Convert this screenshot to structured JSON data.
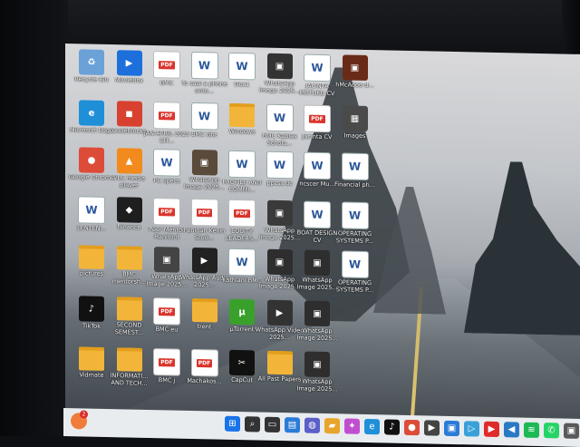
{
  "desktop": {
    "icons": [
      {
        "label": "Recycle Bin",
        "kind": "img",
        "glyph": "♻",
        "color": "#6aa2d8"
      },
      {
        "label": "MovieBox",
        "kind": "img",
        "glyph": "▶",
        "color": "#1d6fdc"
      },
      {
        "label": "BMC",
        "kind": "pdf",
        "glyph": "PDF"
      },
      {
        "label": "To cast a phone onto...",
        "kind": "word",
        "glyph": "W"
      },
      {
        "label": "Doc1",
        "kind": "word",
        "glyph": "W"
      },
      {
        "label": "WhatsApp Image 2025...",
        "kind": "img",
        "glyph": "▣",
        "color": "#333"
      },
      {
        "label": "JACINTA MUTUKU CV",
        "kind": "word",
        "glyph": "W"
      },
      {
        "label": "hMcAdee-d...",
        "kind": "img",
        "glyph": "▣",
        "color": "#6a2a18"
      },
      {
        "label": "Microsoft Edge",
        "kind": "img",
        "glyph": "e",
        "color": "#1f8fd8"
      },
      {
        "label": "CodeBlocks",
        "kind": "img",
        "glyph": "◼",
        "color": "#d8412f"
      },
      {
        "label": "JAN-APRIL 2025 CIT...",
        "kind": "pdf",
        "glyph": "PDF"
      },
      {
        "label": "BMC Bbc",
        "kind": "word",
        "glyph": "W"
      },
      {
        "label": "Windows",
        "kind": "folder",
        "glyph": ""
      },
      {
        "label": "BMC Kabias Schola...",
        "kind": "word",
        "glyph": "W"
      },
      {
        "label": "Jacinta CV",
        "kind": "pdf",
        "glyph": "PDF"
      },
      {
        "label": "Images",
        "kind": "img",
        "glyph": "▦",
        "color": "#4a4a4a"
      },
      {
        "label": "Google Chrome",
        "kind": "img",
        "glyph": "●",
        "color": "#dd4b39"
      },
      {
        "label": "VLC media player",
        "kind": "img",
        "glyph": "▲",
        "color": "#f28a1d"
      },
      {
        "label": "PC specs",
        "kind": "word",
        "glyph": "W"
      },
      {
        "label": "WhatsApp Image 2025...",
        "kind": "img",
        "glyph": "▣",
        "color": "#5a4a3a"
      },
      {
        "label": "PROFILE AND COMMI...",
        "kind": "word",
        "glyph": "W"
      },
      {
        "label": "ppcss.dc",
        "kind": "word",
        "glyph": "W"
      },
      {
        "label": "ncscer Mu...",
        "kind": "word",
        "glyph": "W"
      },
      {
        "label": "Financial ph...",
        "kind": "word",
        "glyph": "W"
      },
      {
        "label": "LENTEN...",
        "kind": "word",
        "glyph": "W"
      },
      {
        "label": "Binance",
        "kind": "img",
        "glyph": "◆",
        "color": "#1e1e1e"
      },
      {
        "label": "Peer Mentor Handout",
        "kind": "pdf",
        "glyph": "PDF"
      },
      {
        "label": "Peninah Kevin Stud...",
        "kind": "pdf",
        "glyph": "PDF"
      },
      {
        "label": "EQUITY LEADERS...",
        "kind": "pdf",
        "glyph": "PDF"
      },
      {
        "label": "WhatsApp Image 2025...",
        "kind": "img",
        "glyph": "▣",
        "color": "#3a3a3a"
      },
      {
        "label": "BOAT DESIGN CV",
        "kind": "word",
        "glyph": "W"
      },
      {
        "label": "OPERATING SYSTEMS P...",
        "kind": "word",
        "glyph": "W"
      },
      {
        "label": "pictures",
        "kind": "folder",
        "glyph": ""
      },
      {
        "label": "BMC mentorsh...",
        "kind": "folder",
        "glyph": ""
      },
      {
        "label": "WhatsApp Image 2025...",
        "kind": "img",
        "glyph": "▣",
        "color": "#444"
      },
      {
        "label": "WhatsApp Audio 2025...",
        "kind": "img",
        "glyph": "▶",
        "color": "#222"
      },
      {
        "label": "kathiani BMC",
        "kind": "word",
        "glyph": "W"
      },
      {
        "label": "WhatsApp Image 2025...",
        "kind": "img",
        "glyph": "▣",
        "color": "#2e2e2e"
      },
      {
        "label": "WhatsApp Image 2025...",
        "kind": "img",
        "glyph": "▣",
        "color": "#2e2e2e"
      },
      {
        "label": "OPERATING SYSTEMS P...",
        "kind": "word",
        "glyph": "W"
      },
      {
        "label": "TikTok",
        "kind": "img",
        "glyph": "♪",
        "color": "#111"
      },
      {
        "label": "SECOND SEMEST...",
        "kind": "folder",
        "glyph": ""
      },
      {
        "label": "BMC eu",
        "kind": "pdf",
        "glyph": "PDF"
      },
      {
        "label": "trent",
        "kind": "folder",
        "glyph": ""
      },
      {
        "label": "µTorrent",
        "kind": "img",
        "glyph": "µ",
        "color": "#3aa02c"
      },
      {
        "label": "WhatsApp Video 2025...",
        "kind": "img",
        "glyph": "▶",
        "color": "#333"
      },
      {
        "label": "WhatsApp Image 2025...",
        "kind": "img",
        "glyph": "▣",
        "color": "#2e2e2e"
      },
      {
        "label": "Vidmate",
        "kind": "folder",
        "glyph": ""
      },
      {
        "label": "INFORMATI... AND TECH...",
        "kind": "folder",
        "glyph": ""
      },
      {
        "label": "BMC j",
        "kind": "pdf",
        "glyph": "PDF"
      },
      {
        "label": "Machakos...",
        "kind": "pdf",
        "glyph": "PDF"
      },
      {
        "label": "CapCut",
        "kind": "img",
        "glyph": "✂",
        "color": "#111"
      },
      {
        "label": "All Past Papers",
        "kind": "folder",
        "glyph": ""
      },
      {
        "label": "WhatsApp Image 2025...",
        "kind": "img",
        "glyph": "▣",
        "color": "#2e2e2e"
      }
    ]
  },
  "taskbar": {
    "notification_count": "2",
    "apps": [
      {
        "name": "start-icon",
        "glyph": "⊞",
        "color": "#1a73e8"
      },
      {
        "name": "search-icon",
        "glyph": "⌕",
        "color": "#333"
      },
      {
        "name": "task-view-icon",
        "glyph": "▭",
        "color": "#333"
      },
      {
        "name": "widgets-icon",
        "glyph": "▤",
        "color": "#2b7bd8"
      },
      {
        "name": "chat-icon",
        "glyph": "◍",
        "color": "#5b5fc7"
      },
      {
        "name": "file-explorer-icon",
        "glyph": "▰",
        "color": "#e7a52b"
      },
      {
        "name": "copilot-icon",
        "glyph": "✦",
        "color": "#c04fd0"
      },
      {
        "name": "edge-icon",
        "glyph": "e",
        "color": "#1f8fd8"
      },
      {
        "name": "tiktok-icon",
        "glyph": "♪",
        "color": "#111"
      },
      {
        "name": "chrome-icon",
        "glyph": "●",
        "color": "#dd4b39"
      },
      {
        "name": "media-icon",
        "glyph": "▶",
        "color": "#444"
      },
      {
        "name": "store-icon",
        "glyph": "▣",
        "color": "#2b7bd8"
      },
      {
        "name": "play-icon",
        "glyph": "▷",
        "color": "#3aa0d8"
      },
      {
        "name": "youtube-icon",
        "glyph": "▶",
        "color": "#e02b2b"
      },
      {
        "name": "vscode-icon",
        "glyph": "◀",
        "color": "#2a79c4"
      },
      {
        "name": "spotify-icon",
        "glyph": "≋",
        "color": "#1db954"
      },
      {
        "name": "whatsapp-icon",
        "glyph": "✆",
        "color": "#25d366"
      },
      {
        "name": "tray-icon",
        "glyph": "▣",
        "color": "#5a5a5a"
      }
    ]
  }
}
